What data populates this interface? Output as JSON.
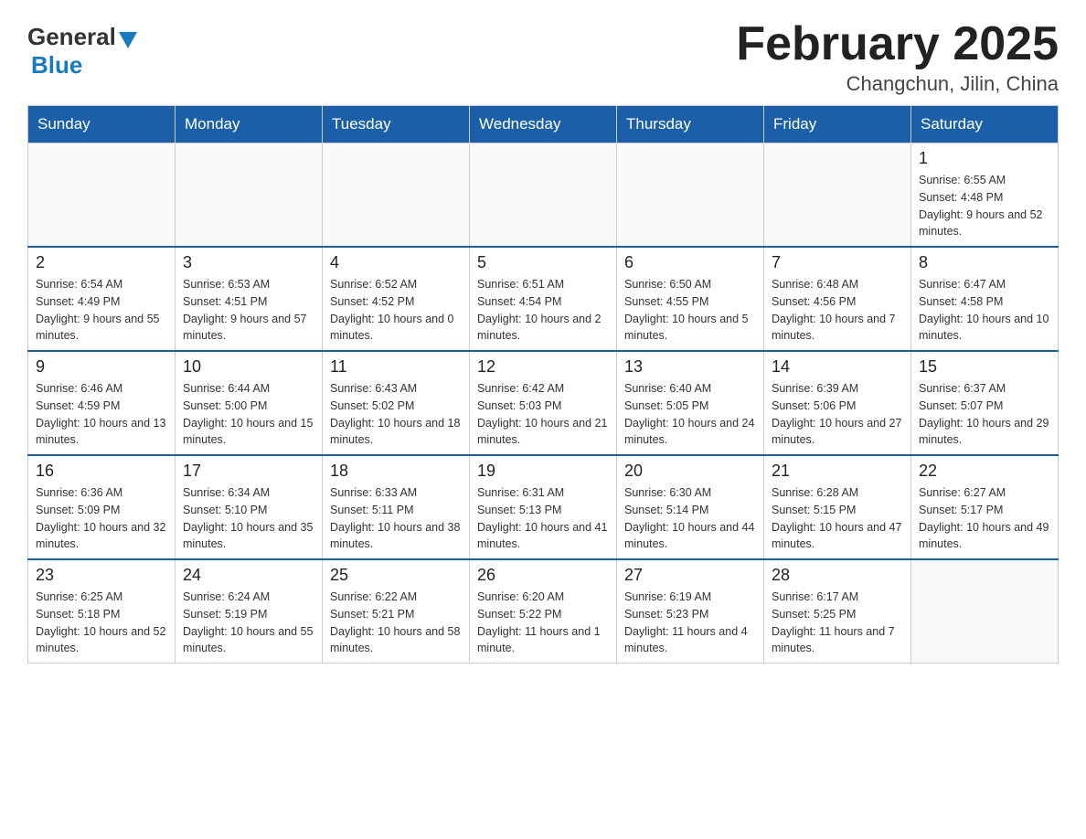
{
  "header": {
    "logo_general": "General",
    "logo_blue": "Blue",
    "title": "February 2025",
    "subtitle": "Changchun, Jilin, China"
  },
  "weekdays": [
    "Sunday",
    "Monday",
    "Tuesday",
    "Wednesday",
    "Thursday",
    "Friday",
    "Saturday"
  ],
  "weeks": [
    [
      {
        "day": "",
        "info": ""
      },
      {
        "day": "",
        "info": ""
      },
      {
        "day": "",
        "info": ""
      },
      {
        "day": "",
        "info": ""
      },
      {
        "day": "",
        "info": ""
      },
      {
        "day": "",
        "info": ""
      },
      {
        "day": "1",
        "info": "Sunrise: 6:55 AM\nSunset: 4:48 PM\nDaylight: 9 hours and 52 minutes."
      }
    ],
    [
      {
        "day": "2",
        "info": "Sunrise: 6:54 AM\nSunset: 4:49 PM\nDaylight: 9 hours and 55 minutes."
      },
      {
        "day": "3",
        "info": "Sunrise: 6:53 AM\nSunset: 4:51 PM\nDaylight: 9 hours and 57 minutes."
      },
      {
        "day": "4",
        "info": "Sunrise: 6:52 AM\nSunset: 4:52 PM\nDaylight: 10 hours and 0 minutes."
      },
      {
        "day": "5",
        "info": "Sunrise: 6:51 AM\nSunset: 4:54 PM\nDaylight: 10 hours and 2 minutes."
      },
      {
        "day": "6",
        "info": "Sunrise: 6:50 AM\nSunset: 4:55 PM\nDaylight: 10 hours and 5 minutes."
      },
      {
        "day": "7",
        "info": "Sunrise: 6:48 AM\nSunset: 4:56 PM\nDaylight: 10 hours and 7 minutes."
      },
      {
        "day": "8",
        "info": "Sunrise: 6:47 AM\nSunset: 4:58 PM\nDaylight: 10 hours and 10 minutes."
      }
    ],
    [
      {
        "day": "9",
        "info": "Sunrise: 6:46 AM\nSunset: 4:59 PM\nDaylight: 10 hours and 13 minutes."
      },
      {
        "day": "10",
        "info": "Sunrise: 6:44 AM\nSunset: 5:00 PM\nDaylight: 10 hours and 15 minutes."
      },
      {
        "day": "11",
        "info": "Sunrise: 6:43 AM\nSunset: 5:02 PM\nDaylight: 10 hours and 18 minutes."
      },
      {
        "day": "12",
        "info": "Sunrise: 6:42 AM\nSunset: 5:03 PM\nDaylight: 10 hours and 21 minutes."
      },
      {
        "day": "13",
        "info": "Sunrise: 6:40 AM\nSunset: 5:05 PM\nDaylight: 10 hours and 24 minutes."
      },
      {
        "day": "14",
        "info": "Sunrise: 6:39 AM\nSunset: 5:06 PM\nDaylight: 10 hours and 27 minutes."
      },
      {
        "day": "15",
        "info": "Sunrise: 6:37 AM\nSunset: 5:07 PM\nDaylight: 10 hours and 29 minutes."
      }
    ],
    [
      {
        "day": "16",
        "info": "Sunrise: 6:36 AM\nSunset: 5:09 PM\nDaylight: 10 hours and 32 minutes."
      },
      {
        "day": "17",
        "info": "Sunrise: 6:34 AM\nSunset: 5:10 PM\nDaylight: 10 hours and 35 minutes."
      },
      {
        "day": "18",
        "info": "Sunrise: 6:33 AM\nSunset: 5:11 PM\nDaylight: 10 hours and 38 minutes."
      },
      {
        "day": "19",
        "info": "Sunrise: 6:31 AM\nSunset: 5:13 PM\nDaylight: 10 hours and 41 minutes."
      },
      {
        "day": "20",
        "info": "Sunrise: 6:30 AM\nSunset: 5:14 PM\nDaylight: 10 hours and 44 minutes."
      },
      {
        "day": "21",
        "info": "Sunrise: 6:28 AM\nSunset: 5:15 PM\nDaylight: 10 hours and 47 minutes."
      },
      {
        "day": "22",
        "info": "Sunrise: 6:27 AM\nSunset: 5:17 PM\nDaylight: 10 hours and 49 minutes."
      }
    ],
    [
      {
        "day": "23",
        "info": "Sunrise: 6:25 AM\nSunset: 5:18 PM\nDaylight: 10 hours and 52 minutes."
      },
      {
        "day": "24",
        "info": "Sunrise: 6:24 AM\nSunset: 5:19 PM\nDaylight: 10 hours and 55 minutes."
      },
      {
        "day": "25",
        "info": "Sunrise: 6:22 AM\nSunset: 5:21 PM\nDaylight: 10 hours and 58 minutes."
      },
      {
        "day": "26",
        "info": "Sunrise: 6:20 AM\nSunset: 5:22 PM\nDaylight: 11 hours and 1 minute."
      },
      {
        "day": "27",
        "info": "Sunrise: 6:19 AM\nSunset: 5:23 PM\nDaylight: 11 hours and 4 minutes."
      },
      {
        "day": "28",
        "info": "Sunrise: 6:17 AM\nSunset: 5:25 PM\nDaylight: 11 hours and 7 minutes."
      },
      {
        "day": "",
        "info": ""
      }
    ]
  ]
}
